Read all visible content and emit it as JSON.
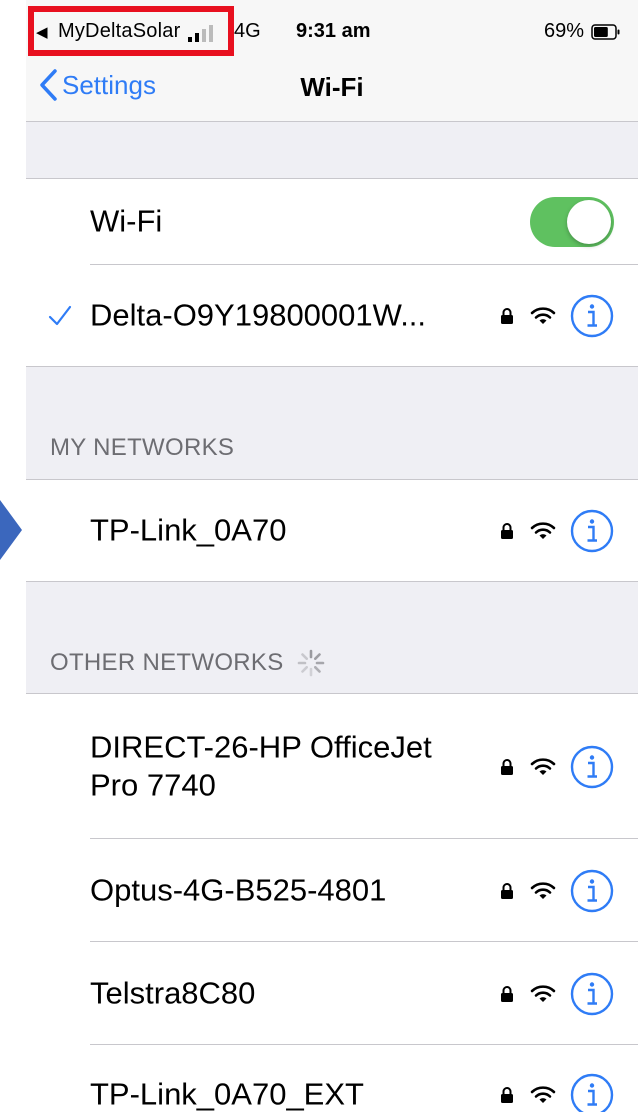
{
  "status_bar": {
    "back_glyph": "◀",
    "app": "MyDeltaSolar",
    "network": "4G",
    "time": "9:31 am",
    "battery": "69%",
    "battery_level": 0.69
  },
  "nav": {
    "back_label": "Settings",
    "title": "Wi-Fi"
  },
  "wifi_toggle": {
    "label": "Wi-Fi",
    "on": true
  },
  "connected": {
    "name": "Delta-O9Y19800001W..."
  },
  "my_networks": {
    "header": "MY NETWORKS",
    "items": [
      {
        "name": "TP-Link_0A70"
      }
    ]
  },
  "other_networks": {
    "header": "OTHER NETWORKS",
    "items": [
      {
        "name": "DIRECT-26-HP OfficeJet Pro 7740"
      },
      {
        "name": "Optus-4G-B525-4801"
      },
      {
        "name": "Telstra8C80"
      },
      {
        "name": "TP-Link_0A70_EXT"
      }
    ]
  },
  "colors": {
    "accent": "#2f7cf6",
    "toggle_on": "#5fc160",
    "highlight": "#e8101f",
    "arrow": "#3b67bd"
  },
  "icons": {
    "check": "checkmark-icon",
    "lock": "lock-icon",
    "wifi": "wifi-signal-icon",
    "info": "info-icon",
    "spinner": "loading-spinner-icon"
  }
}
